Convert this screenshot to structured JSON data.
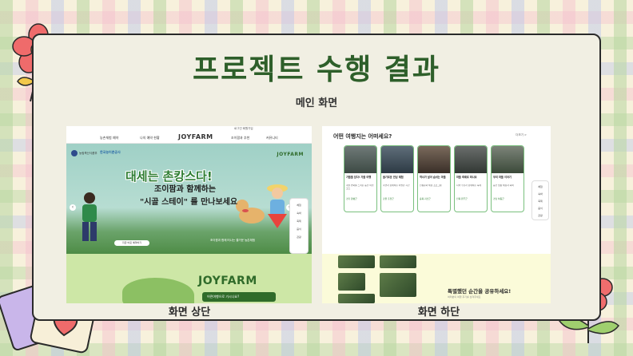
{
  "slide": {
    "title": "프로젝트 수행 결과",
    "subtitle": "메인 화면",
    "caption_top": "화면 상단",
    "caption_bottom": "화면 하단"
  },
  "top_screenshot": {
    "toplinks": "로그인  회원가입",
    "nav_items": [
      "농촌체험 예약",
      "나의 예약 현황",
      "조이팜과 추천",
      "커뮤니티"
    ],
    "brand": "JOYFARM",
    "gov_label": "농림축산식품부",
    "partner_label": "한국농어촌공사",
    "hero_headline": "대세는 촌캉스다!",
    "hero_line1": "조이팜과 함께하는",
    "hero_line2": "\"시골 스테이\" 를 만나보세요",
    "hero_tagline": "조이팜과 함께 떠나는 즐거운 농촌체험",
    "hero_button": "지금 바로 예약하기",
    "side_menu": [
      "체험",
      "숙박",
      "축제",
      "음식",
      "관광"
    ],
    "lower_brand": "JOYFARM",
    "lower_pill": "어떤여행으로 가시나요?"
  },
  "bottom_screenshot": {
    "section_title": "어떤 여행지는 어떠세요?",
    "more_link": "더보기 >",
    "cards": [
      {
        "title": "가을을 담다! 가을 여행",
        "body": "계절 변화를 느끼는 농촌 여행 코스",
        "location": "경기 양평군"
      },
      {
        "title": "슬기로운 만남 체험",
        "body": "자연과 함께하는 특별한 시간",
        "location": "강원 홍천군"
      },
      {
        "title": "역사가 살아 숨쉬는 마을",
        "body": "전통문화 체험 프로그램",
        "location": "충북 괴산군"
      },
      {
        "title": "마을 축제로 떠나요",
        "body": "지역 주민과 함께하는 축제",
        "location": "전북 완주군"
      },
      {
        "title": "우리 마을 이야기",
        "body": "농촌 생활 체험과 숙박",
        "location": "경남 하동군"
      }
    ],
    "side_menu": [
      "체험",
      "숙박",
      "축제",
      "음식",
      "관광"
    ],
    "share_title": "특별했던 순간을 공유하세요!",
    "share_sub": "여러분의 여행 후기를 남겨주세요"
  },
  "colors": {
    "title_green": "#2e5f2a",
    "brand_green": "#2f6b2a",
    "panel_bg": "#f1efe3"
  },
  "icons": [
    "flower-icon",
    "heart-card-icon",
    "tulip-icon"
  ]
}
